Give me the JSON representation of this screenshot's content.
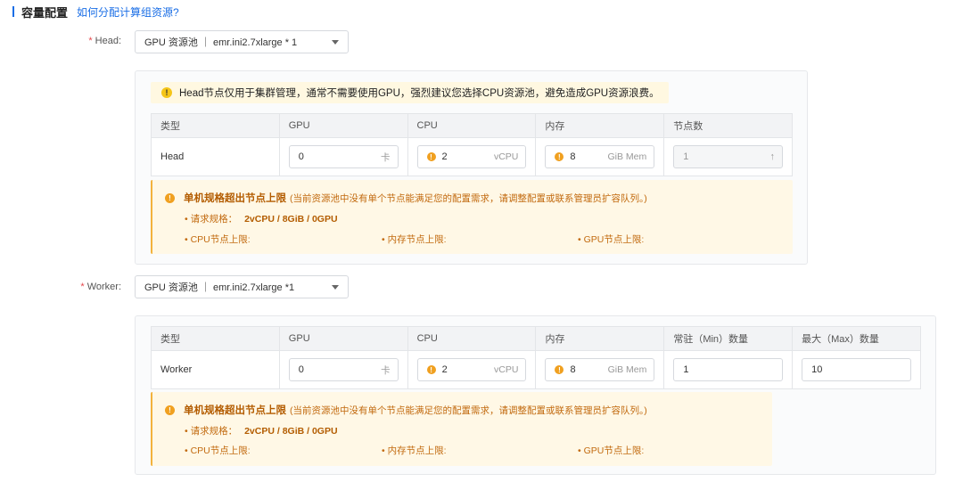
{
  "section": {
    "title": "容量配置",
    "link": "如何分配计算组资源?"
  },
  "head": {
    "label": "Head",
    "select_value": "GPU 资源池 ｜ emr.ini2.7xlarge * 1",
    "tip": "Head节点仅用于集群管理，通常不需要使用GPU，强烈建议您选择CPU资源池，避免造成GPU资源浪费。",
    "columns": [
      "类型",
      "GPU",
      "CPU",
      "内存",
      "节点数"
    ],
    "row": {
      "type": "Head",
      "gpu": "0",
      "gpu_unit": "卡",
      "cpu": "2",
      "cpu_unit": "vCPU",
      "mem": "8",
      "mem_unit": "GiB Mem",
      "nodes": "1"
    },
    "alert": {
      "title": "单机规格超出节点上限",
      "subtitle": "(当前资源池中没有单个节点能满足您的配置需求，请调整配置或联系管理员扩容队列。)",
      "request_label": "• 请求规格：",
      "request_value": "2vCPU / 8GiB / 0GPU",
      "cpu_limit": "• CPU节点上限:",
      "mem_limit": "• 内存节点上限:",
      "gpu_limit": "• GPU节点上限:"
    }
  },
  "worker": {
    "label": "Worker",
    "select_value": "GPU 资源池 ｜ emr.ini2.7xlarge *1",
    "columns": [
      "类型",
      "GPU",
      "CPU",
      "内存",
      "常驻（Min）数量",
      "最大（Max）数量"
    ],
    "row": {
      "type": "Worker",
      "gpu": "0",
      "gpu_unit": "卡",
      "cpu": "2",
      "cpu_unit": "vCPU",
      "mem": "8",
      "mem_unit": "GiB Mem",
      "min": "1",
      "max": "10"
    },
    "alert": {
      "title": "单机规格超出节点上限",
      "subtitle": "(当前资源池中没有单个节点能满足您的配置需求，请调整配置或联系管理员扩容队列。)",
      "request_label": "• 请求规格：",
      "request_value": "2vCPU / 8GiB / 0GPU",
      "cpu_limit": "• CPU节点上限:",
      "mem_limit": "• 内存节点上限:",
      "gpu_limit": "• GPU节点上限:"
    }
  },
  "colors": {
    "accent": "#1a6ee6",
    "warning": "#f0a020",
    "required": "#e5484d"
  }
}
